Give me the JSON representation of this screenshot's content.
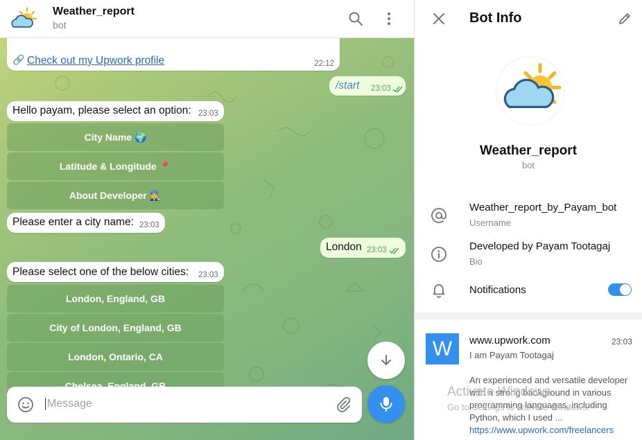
{
  "header": {
    "title": "Weather_report",
    "subtitle": "bot"
  },
  "messages": {
    "link": {
      "text": "Check out my Upwork profile",
      "time": "22:12"
    },
    "start": {
      "text": "/start",
      "time": "23:03"
    },
    "greeting": {
      "text": "Hello payam, please select an option:",
      "time": "23:03"
    },
    "enter_city": {
      "text": "Please enter a city name:",
      "time": "23:03"
    },
    "london": {
      "text": "London",
      "time": "23:03"
    },
    "select_city": {
      "text": "Please select one of the below cities:",
      "time": "23:03"
    }
  },
  "keyboard1": [
    "City Name 🌍",
    "Latitude & Longitude 📍",
    "About Developer 👨‍🔧"
  ],
  "keyboard2": [
    "London, England, GB",
    "City of London, England, GB",
    "London, Ontario, CA",
    "Chelsea, England, GB"
  ],
  "input": {
    "placeholder": "Message"
  },
  "panel": {
    "title": "Bot Info",
    "name": "Weather_report",
    "type": "bot",
    "username": "Weather_report_by_Payam_bot",
    "username_label": "Username",
    "bio": "Developed by Payam Tootagaj",
    "bio_label": "Bio",
    "notifications_label": "Notifications",
    "notifications_on": true
  },
  "link_preview": {
    "avatar_letter": "W",
    "site": "www.upwork.com",
    "time": "23:03",
    "title": "I am Payam Tootagaj",
    "description": "An experienced and versatile developer with a strong background in various programming languages, including Python, which I used ...",
    "url": "https://www.upwork.com/freelancers"
  },
  "watermark": {
    "line1": "Activate Windows",
    "line2": "Go to Settings to activate Windows."
  },
  "colors": {
    "accent": "#3390ec",
    "outgoing_bubble": "#effdde",
    "keyboard_button": "#6ea05f",
    "preview_avatar": "#3390ec"
  },
  "icons": [
    "weather-avatar-icon",
    "search-icon",
    "more-vertical-icon",
    "close-icon",
    "edit-icon",
    "link-icon",
    "double-check-icon",
    "emoji-icon",
    "attach-icon",
    "mic-icon",
    "arrow-down-icon",
    "at-icon",
    "info-icon",
    "bell-icon"
  ]
}
